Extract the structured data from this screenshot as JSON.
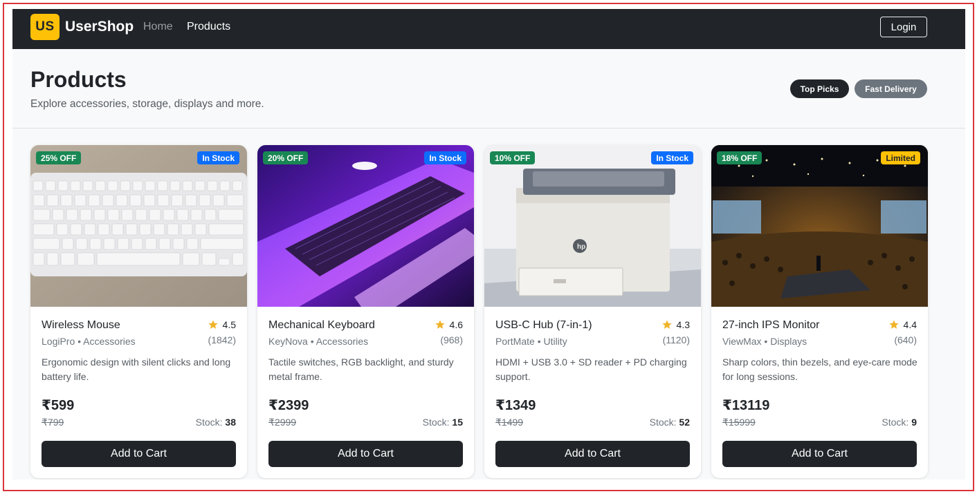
{
  "navbar": {
    "logo_text": "US",
    "brand": "UserShop",
    "links": [
      {
        "label": "Home",
        "active": false
      },
      {
        "label": "Products",
        "active": true
      }
    ],
    "login_label": "Login"
  },
  "header": {
    "title": "Products",
    "subtitle": "Explore accessories, storage, displays and more.",
    "pills": [
      {
        "label": "Top Picks"
      },
      {
        "label": "Fast Delivery"
      }
    ]
  },
  "products": [
    {
      "name": "Wireless Mouse",
      "brand": "LogiPro",
      "category": "Accessories",
      "meta": "LogiPro • Accessories",
      "rating": "4.5",
      "reviews": "(1842)",
      "discount": "25% OFF",
      "availability": "In Stock",
      "description": "Ergonomic design with silent clicks and long battery life.",
      "price": "₹599",
      "old_price": "₹799",
      "stock_label": "Stock:",
      "stock": "38",
      "button": "Add to Cart",
      "image": "keyboard-photo"
    },
    {
      "name": "Mechanical Keyboard",
      "brand": "KeyNova",
      "category": "Accessories",
      "meta": "KeyNova • Accessories",
      "rating": "4.6",
      "reviews": "(968)",
      "discount": "20% OFF",
      "availability": "In Stock",
      "description": "Tactile switches, RGB backlight, and sturdy metal frame.",
      "price": "₹2399",
      "old_price": "₹2999",
      "stock_label": "Stock:",
      "stock": "15",
      "button": "Add to Cart",
      "image": "laptop-photo"
    },
    {
      "name": "USB-C Hub (7-in-1)",
      "brand": "PortMate",
      "category": "Utility",
      "meta": "PortMate • Utility",
      "rating": "4.3",
      "reviews": "(1120)",
      "discount": "10% OFF",
      "availability": "In Stock",
      "description": "HDMI + USB 3.0 + SD reader + PD charging support.",
      "price": "₹1349",
      "old_price": "₹1499",
      "stock_label": "Stock:",
      "stock": "52",
      "button": "Add to Cart",
      "image": "printer-photo"
    },
    {
      "name": "27-inch IPS Monitor",
      "brand": "ViewMax",
      "category": "Displays",
      "meta": "ViewMax • Displays",
      "rating": "4.4",
      "reviews": "(640)",
      "discount": "18% OFF",
      "availability": "Limited",
      "description": "Sharp colors, thin bezels, and eye-care mode for long sessions.",
      "price": "₹13119",
      "old_price": "₹15999",
      "stock_label": "Stock:",
      "stock": "9",
      "button": "Add to Cart",
      "image": "auditorium-photo"
    }
  ],
  "colors": {
    "navbar": "#212529",
    "brand_logo": "#ffc107",
    "discount_badge": "#198754",
    "stock_badge": "#0d6efd",
    "limited_badge": "#ffc107",
    "star": "#f0b429"
  },
  "icons": {
    "rating": "star-icon"
  }
}
